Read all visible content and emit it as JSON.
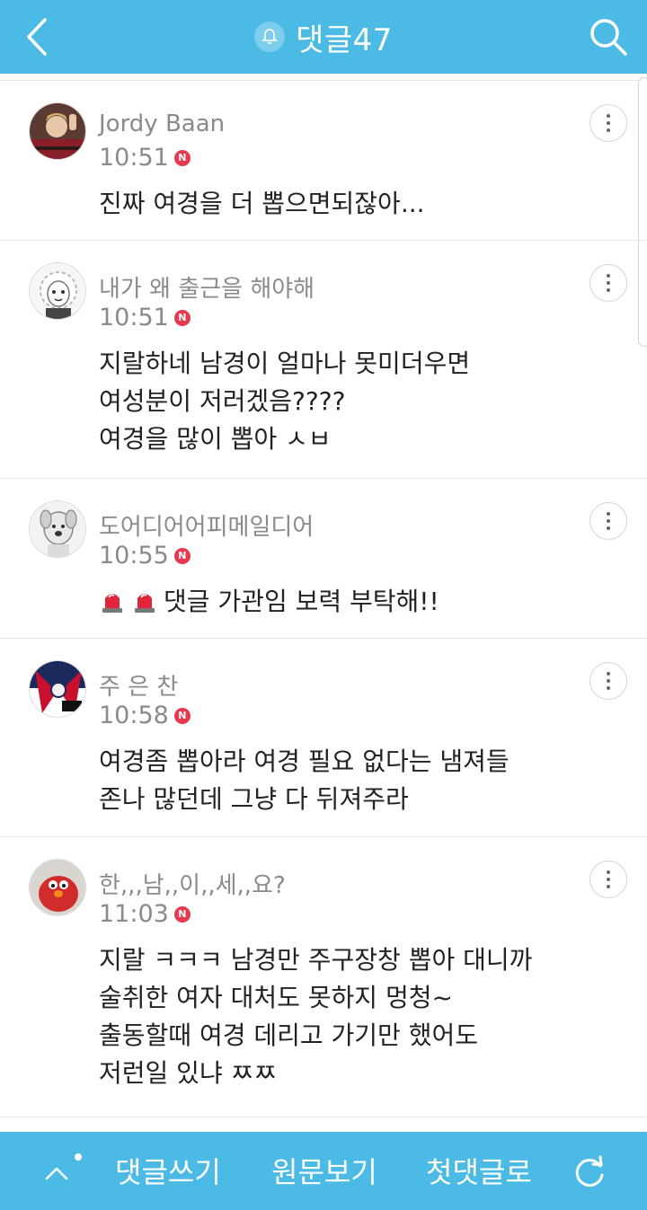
{
  "header": {
    "title": "댓글47",
    "accent": "#4bbbe6"
  },
  "comments": [
    {
      "author": "Jordy Baan",
      "time": "10:51",
      "badge": "N",
      "avatar_icon": "user-photo-avatar",
      "lines": [
        "진짜 여경을 더 뽑으면되잖아..."
      ]
    },
    {
      "author": "내가 왜 출근을 해야해",
      "time": "10:51",
      "badge": "N",
      "avatar_icon": "cartoon-sheep-avatar",
      "lines": [
        "지랄하네 남경이 얼마나 못미더우면",
        "여성분이 저러겠음????",
        "여경을 많이 뽑아 ㅅㅂ"
      ]
    },
    {
      "author": "도어디어어피메일디어",
      "time": "10:55",
      "badge": "N",
      "avatar_icon": "cartoon-dog-avatar",
      "lines": [
        "댓글 가관임 보력 부탁해!!"
      ]
    },
    {
      "author": "주 은 찬",
      "time": "10:58",
      "badge": "N",
      "avatar_icon": "sports-logo-avatar",
      "lines": [
        "여경좀 뽑아라 여경 필요 없다는 냄져들",
        "존나 많던데 그냥 다 뒤져주라"
      ]
    },
    {
      "author": "한,,,남,,이,,세,,요?",
      "time": "11:03",
      "badge": "N",
      "avatar_icon": "red-plush-avatar",
      "lines": [
        "지랄 ㅋㅋㅋ 남경만 주구장창 뽑아 대니까",
        "술취한 여자 대처도 못하지 멍청~",
        "출동할때 여경 데리고 가기만 했어도",
        "저런일 있냐 ㅉㅉ"
      ]
    }
  ],
  "bottom": {
    "write": "댓글쓰기",
    "original": "원문보기",
    "first": "첫댓글로"
  }
}
